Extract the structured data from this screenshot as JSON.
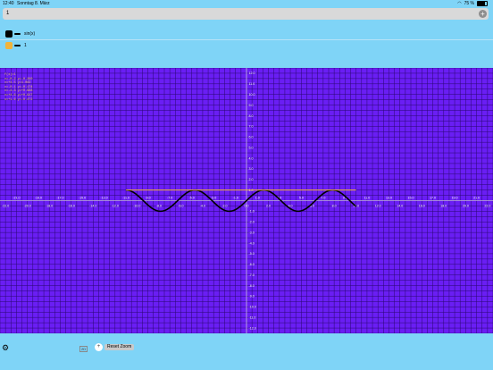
{
  "status": {
    "time": "12:40",
    "date": "Sonntag 8. März",
    "battery": "75 %",
    "battery_level": 0.75
  },
  "input": {
    "value": "1",
    "add_label": "+"
  },
  "functions": [
    {
      "label": "sin(x)",
      "color": "#000000"
    },
    {
      "label": "1",
      "color": "#f0b43c"
    }
  ],
  "readout": [
    "  f(x)=1",
    "  x=-0.2  y=-0.260",
    "  x=+4.5  y=1.083",
    "  x=-0.1  y=-0.174",
    "  x=-4.3  y=+0.968",
    "  x=+4.6  y=+0.947",
    "  x=+1.6  y=-0.472"
  ],
  "chart_data": {
    "type": "line",
    "series": [
      {
        "name": "sin(x)",
        "expr": "sin(x)",
        "x_range": [
          -11,
          10
        ],
        "color": "#000000"
      },
      {
        "name": "1",
        "expr": "1",
        "x_range": [
          -11,
          10
        ],
        "color": "#f0b43c"
      }
    ],
    "xlim": [
      -22.5,
      22.5
    ],
    "ylim": [
      -12.5,
      12.5
    ],
    "x_ticks": [
      -22,
      -21,
      -20,
      -19,
      -18,
      -17,
      -16,
      -15,
      -14,
      -13,
      -12,
      -11,
      -10,
      -9,
      -8,
      -7,
      -6,
      -5,
      -4,
      -3,
      -2,
      -1,
      0,
      1,
      2,
      3,
      4,
      5,
      6,
      7,
      8,
      9,
      10,
      11,
      12,
      13,
      14,
      15,
      16,
      17,
      18,
      19,
      20,
      21,
      22
    ],
    "y_ticks": [
      12,
      11,
      10,
      9,
      8,
      7,
      6,
      5,
      4,
      3,
      2,
      1,
      -1,
      -2,
      -3,
      -4,
      -5,
      -6,
      -7,
      -8,
      -9,
      -10,
      -11,
      -12
    ],
    "background": "#6a1ef4",
    "grid_color": "#2a0870",
    "axis_color": "#ffffff",
    "grid": true
  },
  "bottom": {
    "settings_icon": "gear-icon",
    "mode_label": "2D",
    "zoom_icon": "plus-icon",
    "reset_zoom_label": "Reset Zoom"
  }
}
